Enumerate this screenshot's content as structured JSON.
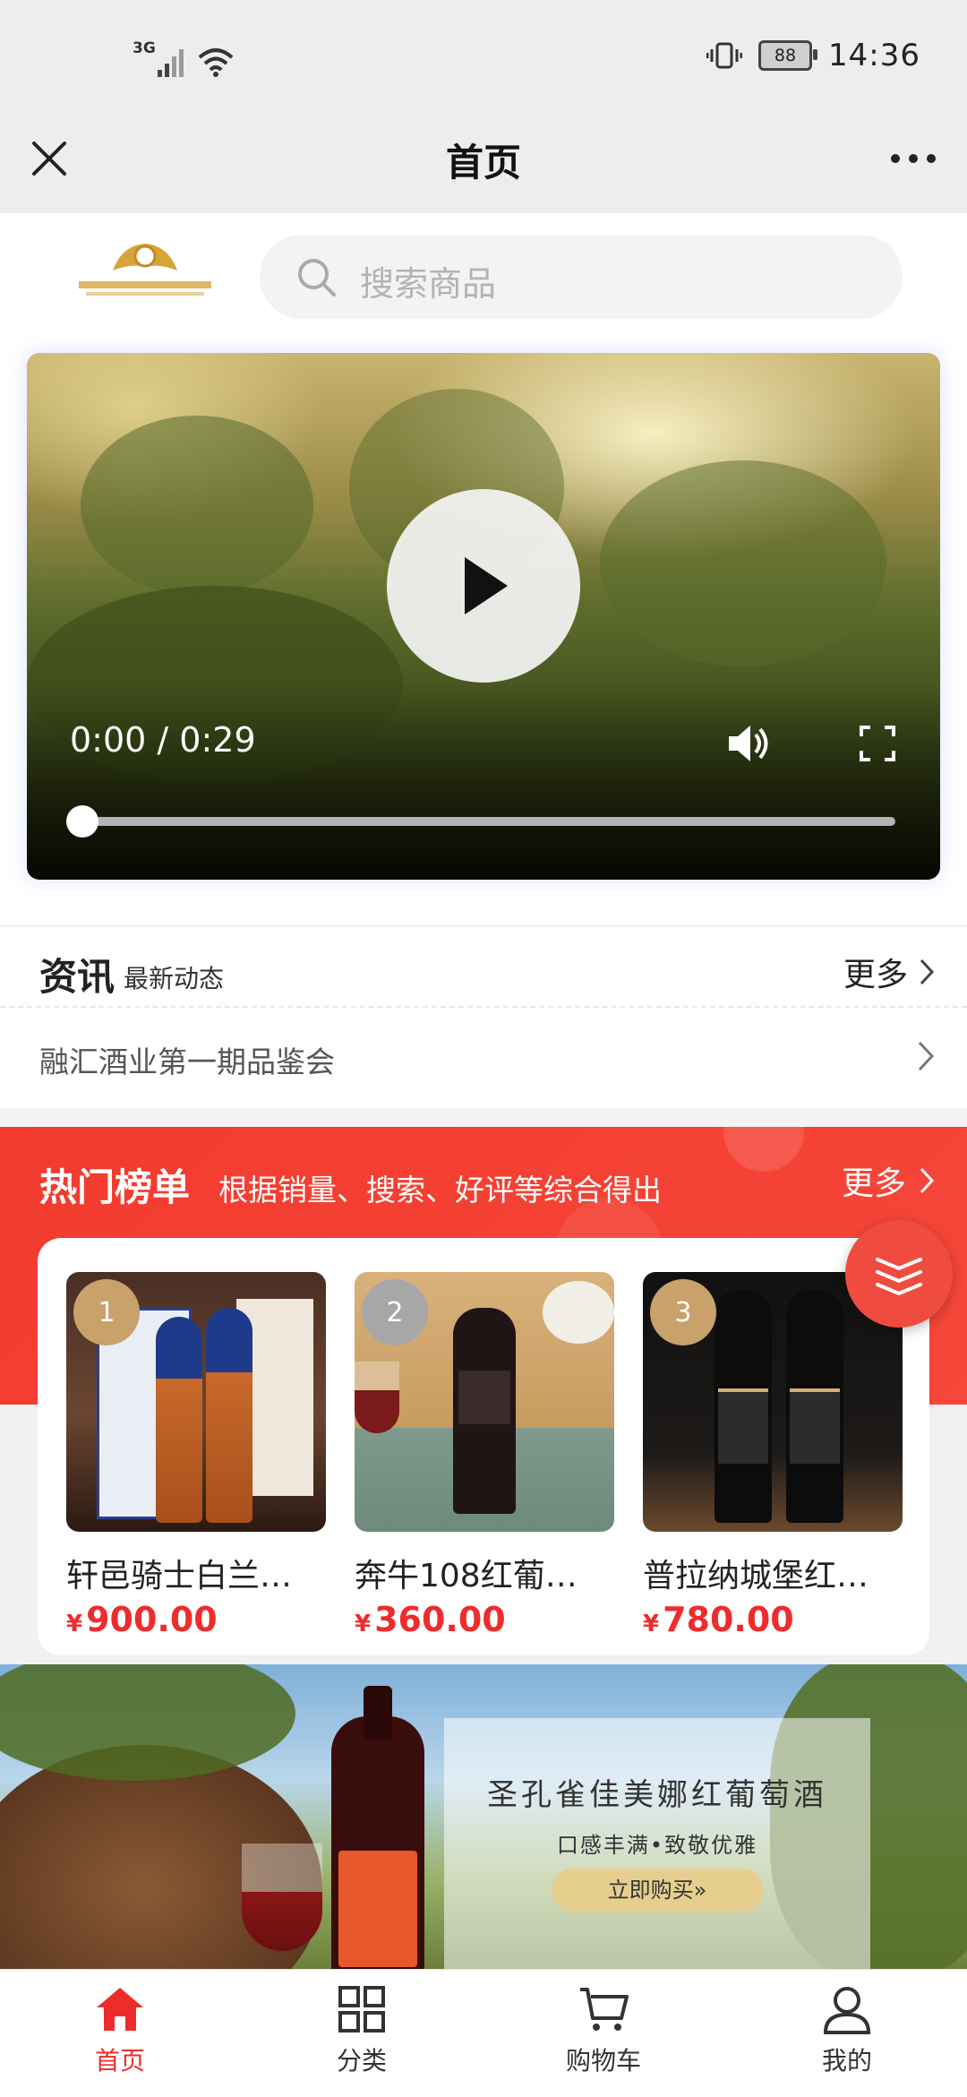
{
  "status_bar": {
    "network": "3G",
    "battery": "88",
    "time": "14:36"
  },
  "nav": {
    "title": "首页"
  },
  "search": {
    "placeholder": "搜索商品"
  },
  "video": {
    "time": "0:00 / 0:29",
    "progress": 0.0
  },
  "news": {
    "title": "资讯",
    "subtitle": "最新动态",
    "more": "更多",
    "items": [
      {
        "title": "融汇酒业第一期品鉴会"
      }
    ]
  },
  "hot": {
    "title": "热门榜单",
    "subtitle": "根据销量、搜索、好评等综合得出",
    "more": "更多",
    "products": [
      {
        "rank": "1",
        "name": "轩邑骑士白兰…",
        "currency": "¥",
        "price": "900.00"
      },
      {
        "rank": "2",
        "name": "奔牛108红葡…",
        "currency": "¥",
        "price": "360.00"
      },
      {
        "rank": "3",
        "name": "普拉纳城堡红…",
        "currency": "¥",
        "price": "780.00"
      }
    ]
  },
  "banner": {
    "headline": "圣孔雀佳美娜红葡萄酒",
    "tagline": "口感丰满•致敬优雅",
    "button": "立即购买»"
  },
  "tabbar": {
    "items": [
      {
        "label": "首页",
        "icon": "home-icon",
        "active": true
      },
      {
        "label": "分类",
        "icon": "grid-icon",
        "active": false
      },
      {
        "label": "购物车",
        "icon": "cart-icon",
        "active": false
      },
      {
        "label": "我的",
        "icon": "user-icon",
        "active": false
      }
    ]
  },
  "colors": {
    "accent": "#ee2c2c",
    "hot_bg": "#f43a2c"
  }
}
